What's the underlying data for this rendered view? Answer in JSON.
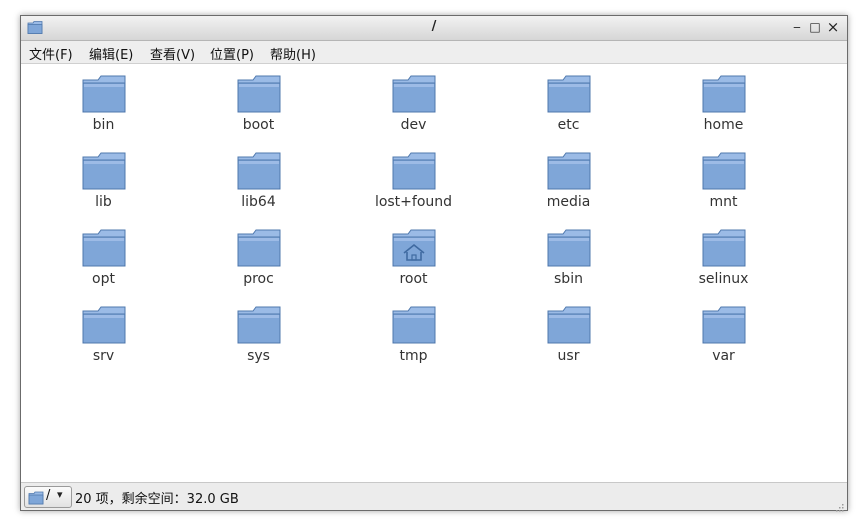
{
  "window": {
    "title": "/",
    "controls": {
      "minimize": "‒",
      "maximize": "□",
      "close": "×"
    }
  },
  "menubar": {
    "items": [
      "文件(F)",
      "编辑(E)",
      "查看(V)",
      "位置(P)",
      "帮助(H)"
    ]
  },
  "folders": [
    {
      "name": "bin",
      "icon": "folder-icon"
    },
    {
      "name": "boot",
      "icon": "folder-icon"
    },
    {
      "name": "dev",
      "icon": "folder-icon"
    },
    {
      "name": "etc",
      "icon": "folder-icon"
    },
    {
      "name": "home",
      "icon": "folder-icon"
    },
    {
      "name": "lib",
      "icon": "folder-icon"
    },
    {
      "name": "lib64",
      "icon": "folder-icon"
    },
    {
      "name": "lost+found",
      "icon": "folder-icon"
    },
    {
      "name": "media",
      "icon": "folder-icon"
    },
    {
      "name": "mnt",
      "icon": "folder-icon"
    },
    {
      "name": "opt",
      "icon": "folder-icon"
    },
    {
      "name": "proc",
      "icon": "folder-icon"
    },
    {
      "name": "root",
      "icon": "home-folder-icon"
    },
    {
      "name": "sbin",
      "icon": "folder-icon"
    },
    {
      "name": "selinux",
      "icon": "folder-icon"
    },
    {
      "name": "srv",
      "icon": "folder-icon"
    },
    {
      "name": "sys",
      "icon": "folder-icon"
    },
    {
      "name": "tmp",
      "icon": "folder-icon"
    },
    {
      "name": "usr",
      "icon": "folder-icon"
    },
    {
      "name": "var",
      "icon": "folder-icon"
    }
  ],
  "statusbar": {
    "path": "/",
    "summary": "20 项，剩余空间：32.0 GB"
  },
  "colors": {
    "folder_body": "#7fa6d8",
    "folder_tab": "#9bbbe6",
    "folder_edge": "#4f78ad"
  }
}
